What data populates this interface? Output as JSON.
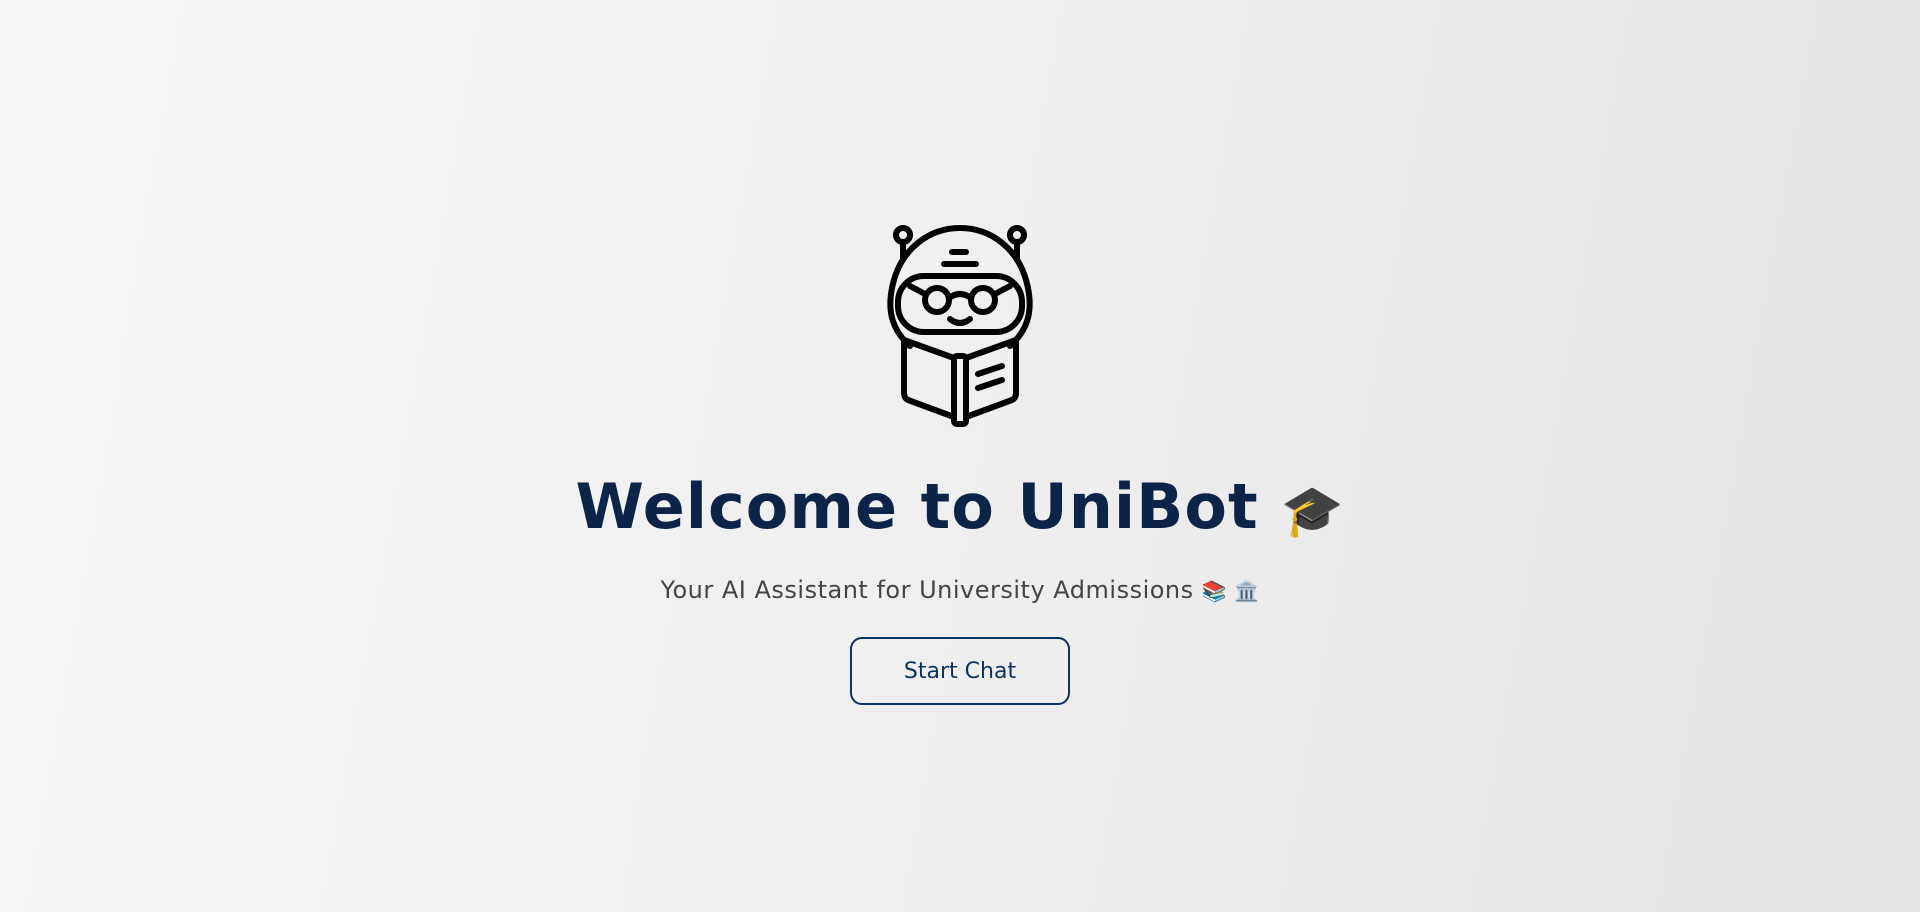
{
  "hero": {
    "title": "Welcome to UniBot",
    "title_emoji": "🎓",
    "subtitle": "Your AI Assistant for University Admissions",
    "subtitle_emojis": "📚 🏛️",
    "start_button_label": "Start Chat"
  },
  "colors": {
    "title": "#0b2447",
    "button": "#0b3466",
    "subtitle": "#444444"
  },
  "icons": {
    "logo": "robot-reading-book-icon"
  }
}
